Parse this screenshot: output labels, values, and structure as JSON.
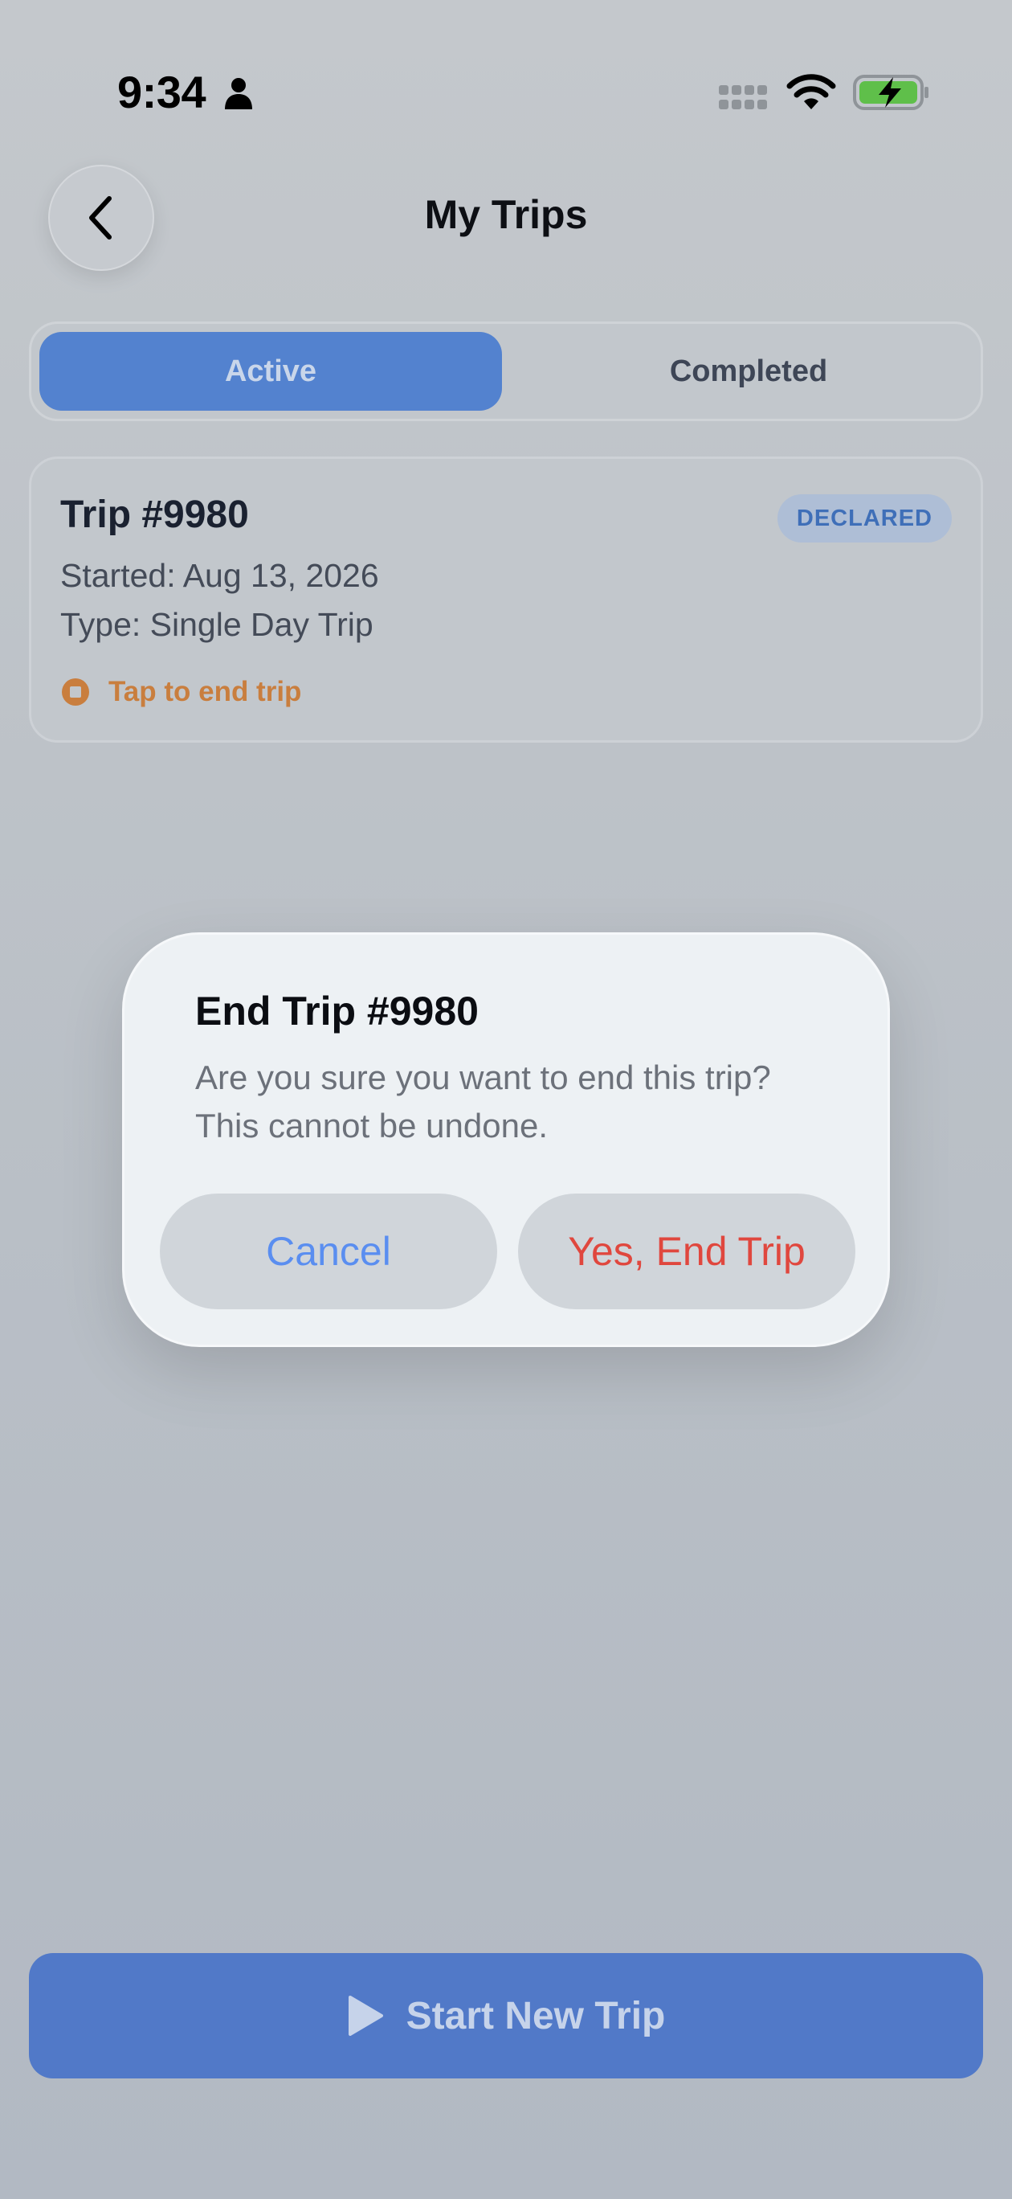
{
  "status_bar": {
    "time": "9:34"
  },
  "header": {
    "title": "My Trips"
  },
  "tabs": [
    {
      "label": "Active",
      "selected": true
    },
    {
      "label": "Completed",
      "selected": false
    }
  ],
  "trip": {
    "title": "Trip #9980",
    "badge": "DECLARED",
    "started": "Started: Aug 13, 2026",
    "type": "Type: Single Day Trip",
    "action": "Tap to end trip"
  },
  "dialog": {
    "title": "End Trip #9980",
    "message": "Are you sure you want to end this trip? This cannot be undone.",
    "cancel_label": "Cancel",
    "confirm_label": "Yes, End Trip"
  },
  "footer": {
    "start_label": "Start New Trip"
  },
  "colors": {
    "accent": "#5382cf",
    "warning": "#c97e3e",
    "danger": "#e0473e",
    "link": "#5a8ef0",
    "battery_fill": "#5fbf4a"
  }
}
